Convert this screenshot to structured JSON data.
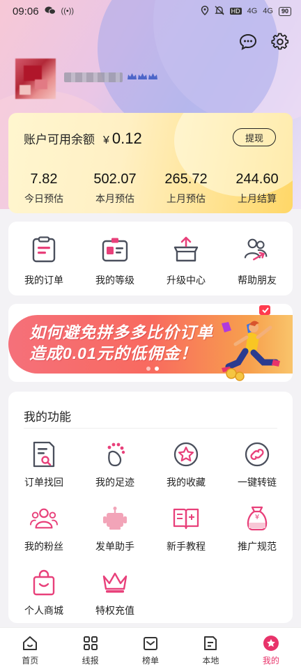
{
  "status_bar": {
    "time": "09:06",
    "signal_1": "4G",
    "signal_2": "4G",
    "battery": "90"
  },
  "header": {
    "message_icon": "chat-bubble-icon",
    "settings_icon": "gear-icon"
  },
  "balance": {
    "label": "账户可用余额",
    "currency": "¥",
    "value": "0.12",
    "withdraw_label": "提现",
    "stats": [
      {
        "value": "7.82",
        "label": "今日预估"
      },
      {
        "value": "502.07",
        "label": "本月预估"
      },
      {
        "value": "265.72",
        "label": "上月预估"
      },
      {
        "value": "244.60",
        "label": "上月结算"
      }
    ]
  },
  "quick_actions": [
    {
      "label": "我的订单",
      "icon": "clipboard-icon"
    },
    {
      "label": "我的等级",
      "icon": "id-card-icon"
    },
    {
      "label": "升级中心",
      "icon": "box-upload-icon"
    },
    {
      "label": "帮助朋友",
      "icon": "friends-icon"
    }
  ],
  "banner": {
    "line1": "如何避免拼多多比价订单",
    "line2": "造成0.01元的低佣金！"
  },
  "functions": {
    "title": "我的功能",
    "items": [
      {
        "label": "订单找回",
        "icon": "document-search-icon"
      },
      {
        "label": "我的足迹",
        "icon": "footprint-icon"
      },
      {
        "label": "我的收藏",
        "icon": "star-circle-icon"
      },
      {
        "label": "一键转链",
        "icon": "link-circle-icon"
      },
      {
        "label": "我的粉丝",
        "icon": "fans-icon"
      },
      {
        "label": "发单助手",
        "icon": "robot-icon"
      },
      {
        "label": "新手教程",
        "icon": "book-icon"
      },
      {
        "label": "推广规范",
        "icon": "money-bag-icon"
      },
      {
        "label": "个人商城",
        "icon": "shopping-bag-icon"
      },
      {
        "label": "特权充值",
        "icon": "crown-icon"
      }
    ]
  },
  "tabbar": [
    {
      "label": "首页",
      "icon": "home-icon",
      "active": false
    },
    {
      "label": "线报",
      "icon": "grid-icon",
      "active": false
    },
    {
      "label": "榜单",
      "icon": "ranking-icon",
      "active": false
    },
    {
      "label": "本地",
      "icon": "document-icon",
      "active": false
    },
    {
      "label": "我的",
      "icon": "profile-star-icon",
      "active": true
    }
  ],
  "colors": {
    "accent": "#e8336a",
    "icon_gray": "#4a4f5c",
    "icon_pink": "#e8407a"
  }
}
